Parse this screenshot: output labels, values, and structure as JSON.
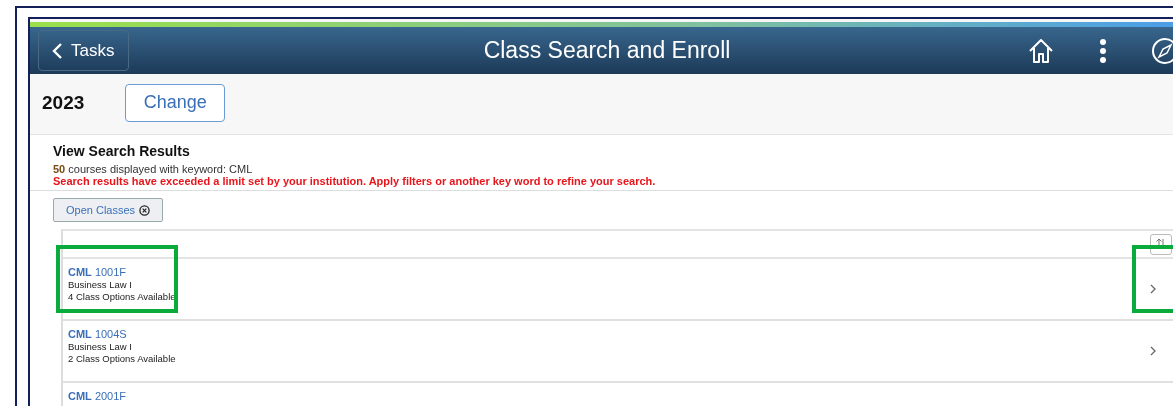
{
  "header": {
    "back_label": "Tasks",
    "title": "Class Search and Enroll"
  },
  "term": {
    "year": "2023",
    "change_label": "Change"
  },
  "results": {
    "heading": "View Search Results",
    "count": "50",
    "summary": "courses displayed with keyword: CML",
    "warning": "Search results have exceeded a limit set by your institution. Apply filters or another key word to refine your search.",
    "filter": {
      "label": "Open Classes"
    },
    "courses": [
      {
        "subject": "CML",
        "number": "1001F",
        "title": "Business Law I",
        "options": "4 Class Options Available",
        "highlighted": true
      },
      {
        "subject": "CML",
        "number": "1004S",
        "title": "Business Law I",
        "options": "2 Class Options Available",
        "highlighted": false
      },
      {
        "subject": "CML",
        "number": "2001F",
        "highlighted": false
      }
    ]
  }
}
